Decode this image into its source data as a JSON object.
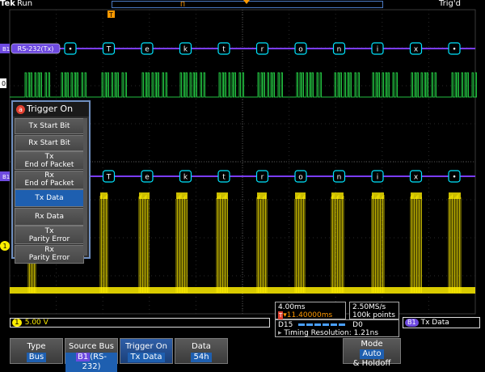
{
  "brand": "Tek",
  "run_state": "Run",
  "trig_state": "Trig'd",
  "markers": {
    "trigger": "T",
    "cursor": "Π"
  },
  "bus": {
    "label": "RS-232(Tx)",
    "lane_label": "B1",
    "symbols": [
      "•",
      "T",
      "e",
      "k",
      "t",
      "r",
      "o",
      "n",
      "i",
      "x",
      "•"
    ],
    "color": "#7a3cff",
    "packet_color": "#00e5ff"
  },
  "digital": {
    "label": "0",
    "color": "#22c040"
  },
  "analog": {
    "label": "1",
    "color": "#ffee00"
  },
  "trigger_menu": {
    "title": "Trigger On",
    "items": [
      "Tx Start Bit",
      "Rx Start Bit",
      "Tx\nEnd of Packet",
      "Rx\nEnd of Packet",
      "Tx Data",
      "Rx Data",
      "Tx\nParity Error",
      "Rx\nParity Error"
    ],
    "selected_index": 4
  },
  "readouts": {
    "horizontal_scale": "4.00ms",
    "trigger_position": "▾11.40000ms",
    "sample_rate": "2.50MS/s",
    "record_length": "100k points",
    "digital_range_hi": "D15",
    "digital_range_lo": "D0",
    "timing_resolution_label": "Timing Resolution:",
    "timing_resolution_value": "1.21ns",
    "ch1_scale": "5.00 V",
    "bus_channel": "B1",
    "bus_trigger": "Tx Data"
  },
  "softkeys": {
    "type": {
      "label": "Type",
      "value": "Bus"
    },
    "source_bus": {
      "label": "Source Bus",
      "badge": "B1",
      "value": "(RS-232)"
    },
    "trigger_on": {
      "label": "Trigger On",
      "value": "Tx Data"
    },
    "data": {
      "label": "Data",
      "value": "54h"
    },
    "mode": {
      "label": "Mode",
      "value": "Auto",
      "value2": "& Holdoff"
    }
  }
}
